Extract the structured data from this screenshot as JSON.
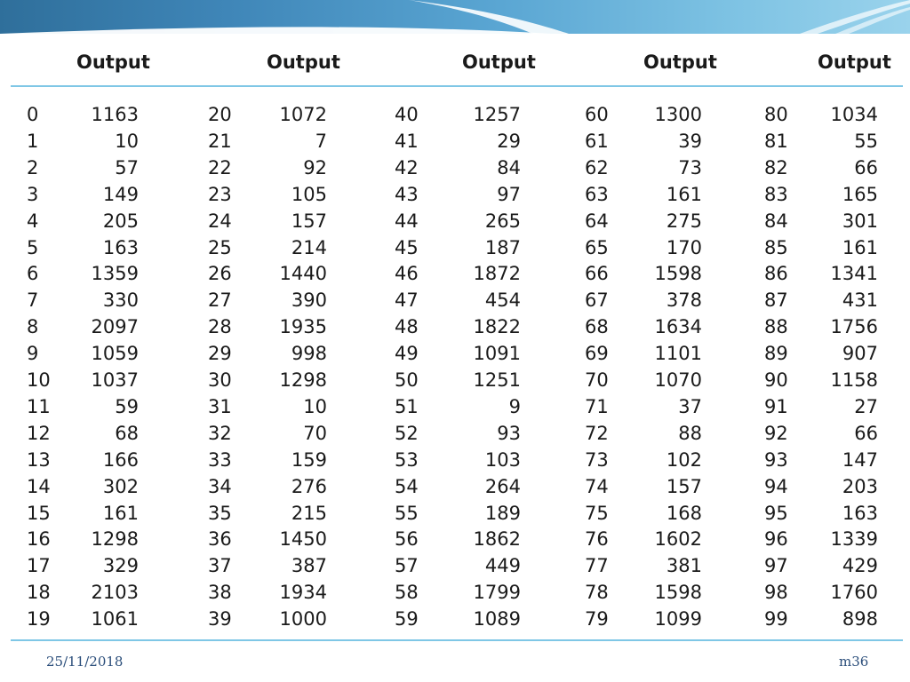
{
  "table": {
    "headers": [
      "Output",
      "Output",
      "Output",
      "Output",
      "Output"
    ],
    "groups": [
      {
        "indices": [
          "0",
          "1",
          "2",
          "3",
          "4",
          "5",
          "6",
          "7",
          "8",
          "9",
          "10",
          "11",
          "12",
          "13",
          "14",
          "15",
          "16",
          "17",
          "18",
          "19"
        ],
        "values": [
          "1163",
          "10",
          "57",
          "149",
          "205",
          "163",
          "1359",
          "330",
          "2097",
          "1059",
          "1037",
          "59",
          "68",
          "166",
          "302",
          "161",
          "1298",
          "329",
          "2103",
          "1061"
        ]
      },
      {
        "indices": [
          "20",
          "21",
          "22",
          "23",
          "24",
          "25",
          "26",
          "27",
          "28",
          "29",
          "30",
          "31",
          "32",
          "33",
          "34",
          "35",
          "36",
          "37",
          "38",
          "39"
        ],
        "values": [
          "1072",
          "7",
          "92",
          "105",
          "157",
          "214",
          "1440",
          "390",
          "1935",
          "998",
          "1298",
          "10",
          "70",
          "159",
          "276",
          "215",
          "1450",
          "387",
          "1934",
          "1000"
        ]
      },
      {
        "indices": [
          "40",
          "41",
          "42",
          "43",
          "44",
          "45",
          "46",
          "47",
          "48",
          "49",
          "50",
          "51",
          "52",
          "53",
          "54",
          "55",
          "56",
          "57",
          "58",
          "59"
        ],
        "values": [
          "1257",
          "29",
          "84",
          "97",
          "265",
          "187",
          "1872",
          "454",
          "1822",
          "1091",
          "1251",
          "9",
          "93",
          "103",
          "264",
          "189",
          "1862",
          "449",
          "1799",
          "1089"
        ]
      },
      {
        "indices": [
          "60",
          "61",
          "62",
          "63",
          "64",
          "65",
          "66",
          "67",
          "68",
          "69",
          "70",
          "71",
          "72",
          "73",
          "74",
          "75",
          "76",
          "77",
          "78",
          "79"
        ],
        "values": [
          "1300",
          "39",
          "73",
          "161",
          "275",
          "170",
          "1598",
          "378",
          "1634",
          "1101",
          "1070",
          "37",
          "88",
          "102",
          "157",
          "168",
          "1602",
          "381",
          "1598",
          "1099"
        ]
      },
      {
        "indices": [
          "80",
          "81",
          "82",
          "83",
          "84",
          "85",
          "86",
          "87",
          "88",
          "89",
          "90",
          "91",
          "92",
          "93",
          "94",
          "95",
          "96",
          "97",
          "98",
          "99"
        ],
        "values": [
          "1034",
          "55",
          "66",
          "165",
          "301",
          "161",
          "1341",
          "431",
          "1756",
          "907",
          "1158",
          "27",
          "66",
          "147",
          "203",
          "163",
          "1339",
          "429",
          "1760",
          "898"
        ]
      }
    ]
  },
  "footer": {
    "date": "25/11/2018",
    "page": "m36"
  },
  "colors": {
    "rule": "#7fc7e6",
    "band_dark": "#2f6f9b",
    "band_light": "#9ad3ec",
    "footer_text": "#2a4d7a"
  }
}
